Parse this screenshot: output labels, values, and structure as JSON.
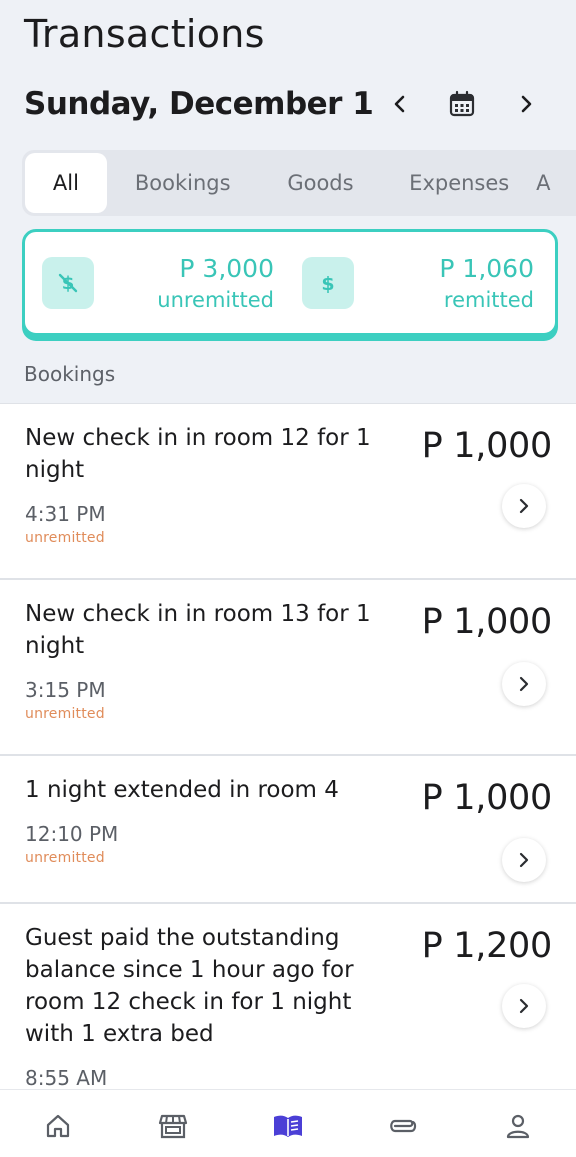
{
  "header": {
    "title": "Transactions",
    "date_label": "Sunday, December 1",
    "prev_icon": "chevron-left-icon",
    "calendar_icon": "calendar-icon",
    "next_icon": "chevron-right-icon"
  },
  "tabs": [
    {
      "label": "All",
      "active": true
    },
    {
      "label": "Bookings",
      "active": false
    },
    {
      "label": "Goods",
      "active": false
    },
    {
      "label": "Expenses",
      "active": false
    },
    {
      "label": "A",
      "active": false
    }
  ],
  "summary": {
    "unremitted": {
      "amount": "P 3,000",
      "label": "unremitted",
      "icon": "no-dollar-icon"
    },
    "remitted": {
      "amount": "P 1,060",
      "label": "remitted",
      "icon": "dollar-icon"
    },
    "accent_color": "#3ccfc1"
  },
  "section_label": "Bookings",
  "transactions": [
    {
      "description": "New check in in room 12 for 1 night",
      "time": "4:31 PM",
      "status": "unremitted",
      "amount": "P 1,000"
    },
    {
      "description": "New check in in room 13 for 1 night",
      "time": "3:15 PM",
      "status": "unremitted",
      "amount": "P 1,000"
    },
    {
      "description": "1 night extended in room 4",
      "time": "12:10 PM",
      "status": "unremitted",
      "amount": "P 1,000"
    },
    {
      "description": "Guest paid the outstanding balance since 1 hour ago for room 12 check in for 1 night with 1 extra bed",
      "time": "8:55 AM",
      "status": "",
      "amount": "P 1,200"
    }
  ],
  "bottom_nav": [
    {
      "icon": "home-icon",
      "active": false
    },
    {
      "icon": "store-icon",
      "active": false
    },
    {
      "icon": "book-icon",
      "active": true
    },
    {
      "icon": "paperclip-icon",
      "active": false
    },
    {
      "icon": "user-icon",
      "active": false
    }
  ],
  "colors": {
    "status_unremitted": "#e08c5a",
    "active_nav": "#4b3fd6",
    "inactive_nav": "#5b5f66"
  }
}
